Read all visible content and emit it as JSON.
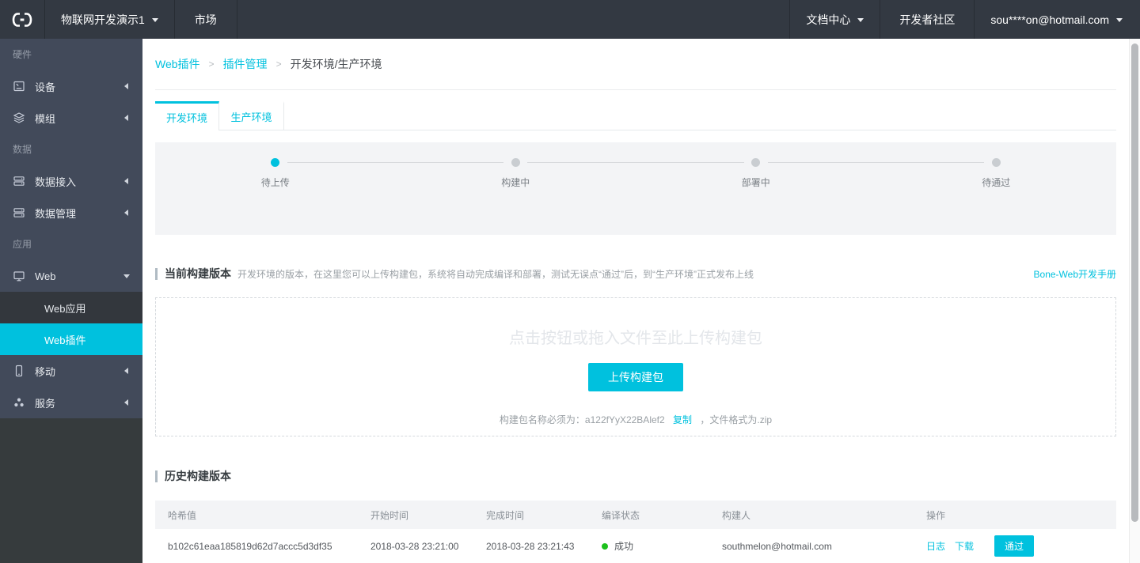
{
  "colors": {
    "accent": "#00c1de",
    "success": "#1dc11d"
  },
  "topbar": {
    "project": "物联网开发演示1",
    "market": "市场",
    "docs": "文档中心",
    "community": "开发者社区",
    "account": "sou****on@hotmail.com"
  },
  "sidebar": {
    "sections": [
      {
        "label": "硬件",
        "items": [
          {
            "label": "设备",
            "icon": "device-icon"
          },
          {
            "label": "模组",
            "icon": "module-icon"
          }
        ]
      },
      {
        "label": "数据",
        "items": [
          {
            "label": "数据接入",
            "icon": "data-access-icon"
          },
          {
            "label": "数据管理",
            "icon": "data-manage-icon"
          }
        ]
      },
      {
        "label": "应用",
        "items": [
          {
            "label": "Web",
            "icon": "web-icon",
            "expanded": true,
            "children": [
              {
                "label": "Web应用",
                "selected": false
              },
              {
                "label": "Web插件",
                "selected": true
              }
            ]
          },
          {
            "label": "移动",
            "icon": "mobile-icon"
          },
          {
            "label": "服务",
            "icon": "service-icon"
          }
        ]
      }
    ]
  },
  "breadcrumb": {
    "items": [
      "Web插件",
      "插件管理",
      "开发环境/生产环境"
    ],
    "separator": ">"
  },
  "tabs": [
    {
      "label": "开发环境",
      "active": true
    },
    {
      "label": "生产环境",
      "active": false
    }
  ],
  "stepper": {
    "steps": [
      {
        "label": "待上传",
        "active": true
      },
      {
        "label": "构建中",
        "active": false
      },
      {
        "label": "部署中",
        "active": false
      },
      {
        "label": "待通过",
        "active": false
      }
    ]
  },
  "current": {
    "title": "当前构建版本",
    "description": "开发环境的版本，在这里您可以上传构建包，系统将自动完成编译和部署，测试无误点“通过”后，到“生产环境”正式发布上线",
    "manual_link": "Bone-Web开发手册",
    "upload": {
      "placeholder": "点击按钮或拖入文件至此上传构建包",
      "button_label": "上传构建包",
      "note_prefix": "构建包名称必须为：a122fYyX22BAlef2",
      "copy_label": "复制",
      "note_suffix": "，文件格式为.zip"
    }
  },
  "history": {
    "title": "历史构建版本",
    "columns": [
      "哈希值",
      "开始时间",
      "完成时间",
      "编译状态",
      "构建人",
      "操作"
    ],
    "rows": [
      {
        "hash": "b102c61eaa185819d62d7accc5d3df35",
        "start_time": "2018-03-28 23:21:00",
        "end_time": "2018-03-28 23:21:43",
        "status": "成功",
        "builder": "southmelon@hotmail.com",
        "actions": {
          "log": "日志",
          "download": "下载",
          "approve": "通过"
        }
      }
    ]
  }
}
